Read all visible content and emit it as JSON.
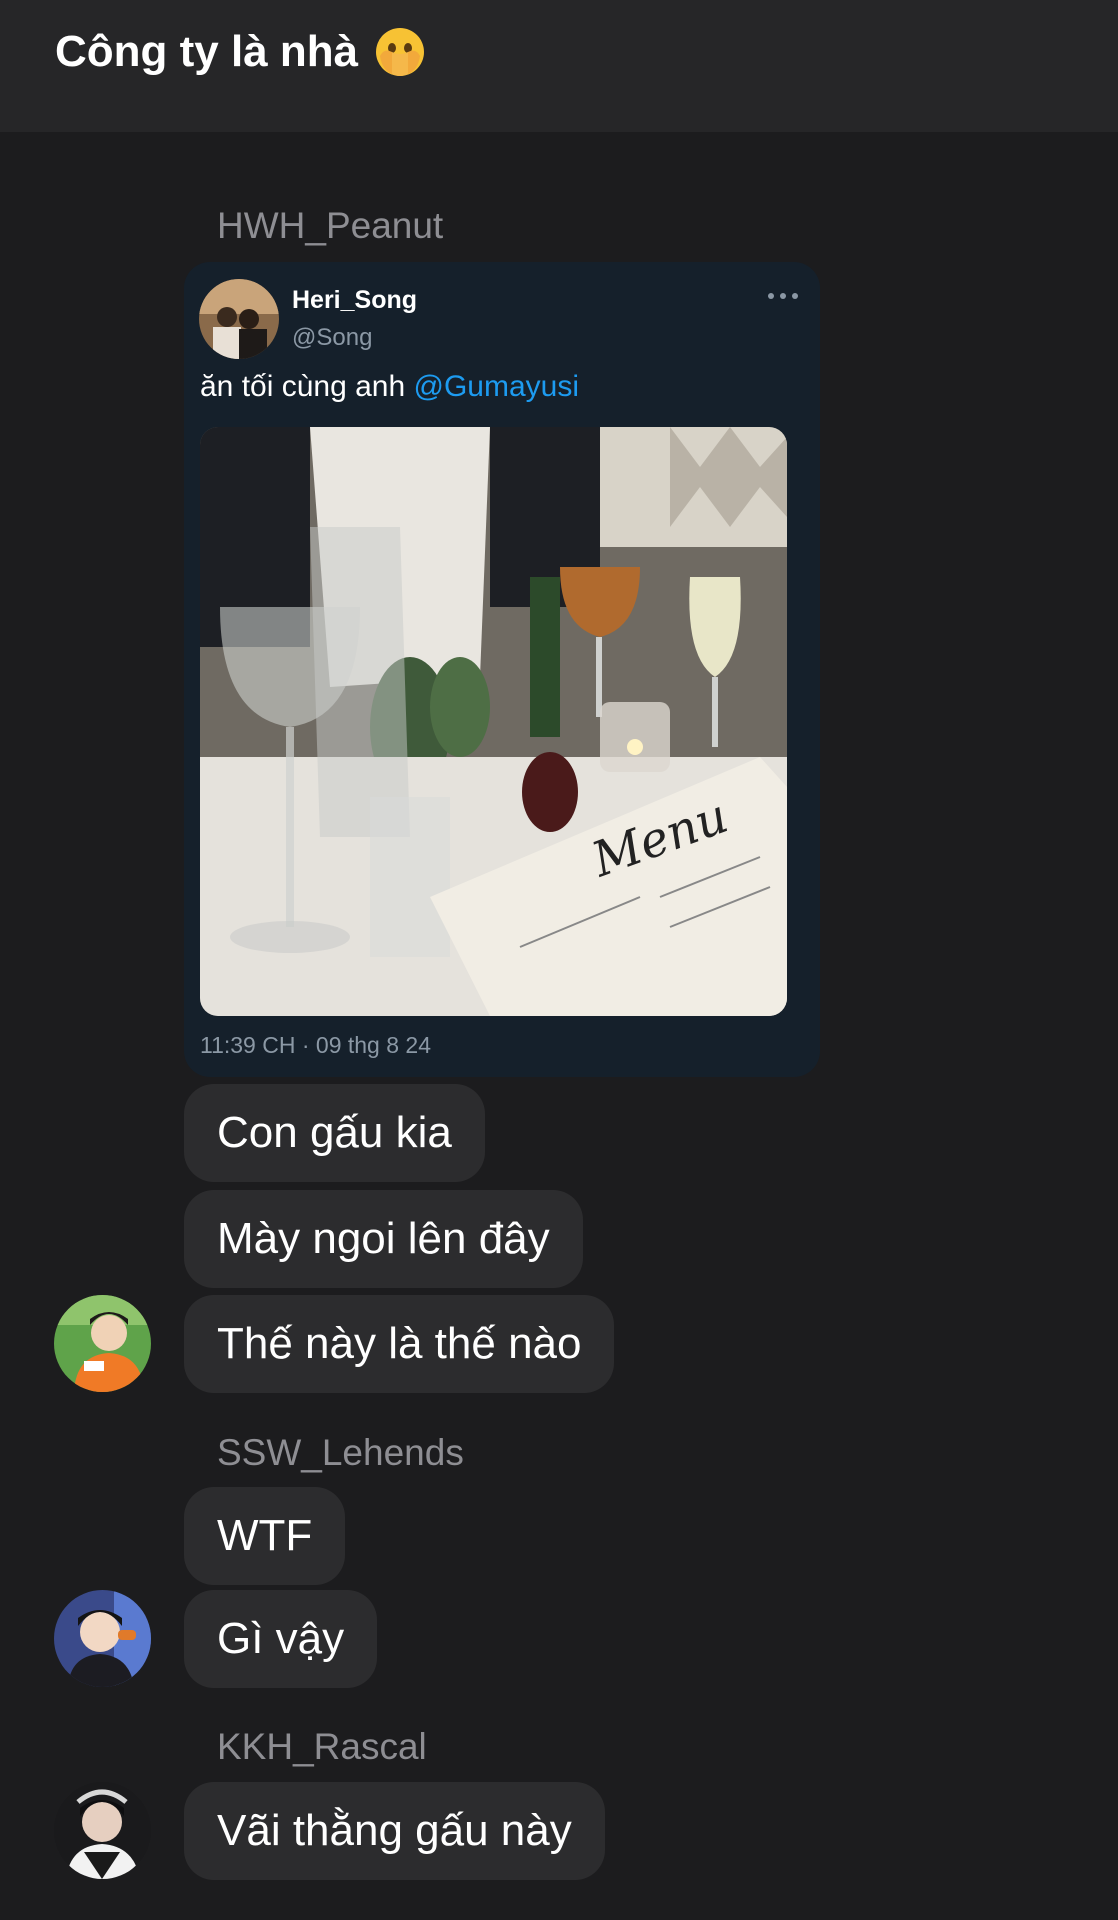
{
  "header": {
    "title": "Công ty là nhà",
    "emoji_icon": "face-with-hands-over-mouth-emoji"
  },
  "messages": [
    {
      "sender": "HWH_Peanut",
      "tweet": {
        "name": "Heri_Song",
        "handle": "@Song",
        "text_prefix": "ăn tối cùng anh ",
        "mention": "@Gumayusi",
        "timestamp": "11:39 CH · 09 thg 8 24",
        "more_icon": "ellipsis-icon"
      },
      "bubbles": [
        "Con gấu kia",
        "Mày ngoi lên đây",
        "Thế này là thế nào"
      ]
    },
    {
      "sender": "SSW_Lehends",
      "bubbles": [
        "WTF",
        "Gì vậy"
      ]
    },
    {
      "sender": "KKH_Rascal",
      "bubbles": [
        "Vãi thằng gấu này"
      ]
    }
  ],
  "colors": {
    "background": "#1c1c1e",
    "header": "#262628",
    "bubble": "#2c2c2e",
    "sender": "#8e8e93",
    "tweet_card": "#15202b",
    "mention": "#1d9bf0"
  }
}
